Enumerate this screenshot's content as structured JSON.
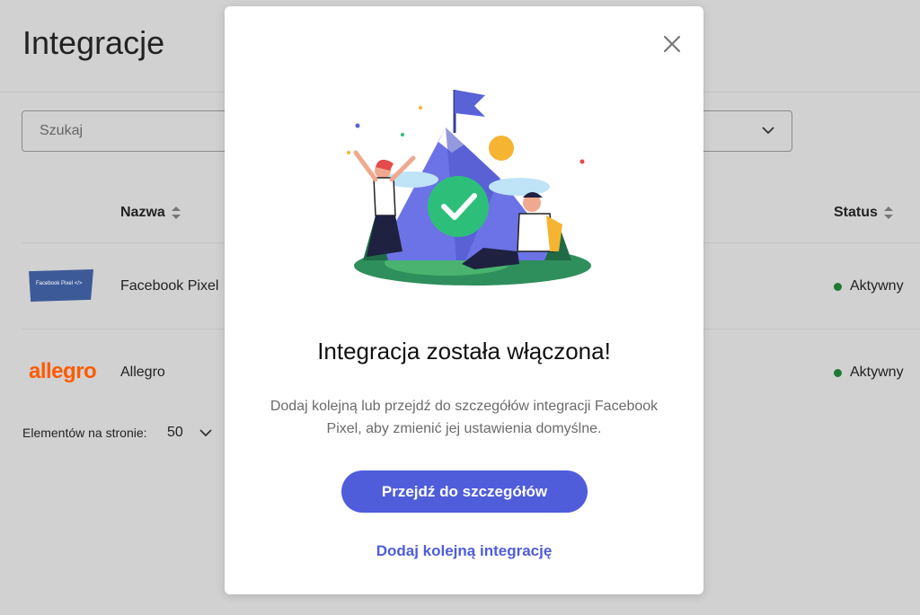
{
  "page": {
    "title": "Integracje",
    "search": {
      "placeholder": "Szukaj"
    },
    "table": {
      "columns": [
        "Nazwa",
        "Status"
      ],
      "rows": [
        {
          "logo": "facebook-pixel-logo",
          "logo_text": "Facebook Pixel </>",
          "name": "Facebook Pixel",
          "status": "Aktywny"
        },
        {
          "logo": "allegro-logo",
          "logo_text": "allegro",
          "name": "Allegro",
          "status": "Aktywny"
        }
      ]
    },
    "pagination": {
      "label": "Elementów na stronie:",
      "value": "50"
    }
  },
  "modal": {
    "title": "Integracja została włączona!",
    "description": "Dodaj kolejną lub przejdź do szczegółów integracji Facebook Pixel, aby zmienić jej ustawienia domyślne.",
    "primary_button": "Przejdź do szczegółów",
    "secondary_link": "Dodaj kolejną integrację",
    "close_icon": "close-icon"
  },
  "colors": {
    "primary": "#4f5ddb",
    "status_active": "#1f7a35",
    "allegro": "#ff5a00",
    "facebook": "#3d5a98",
    "success": "#2dbf7a",
    "overlay_background": "#d1d1d1"
  }
}
